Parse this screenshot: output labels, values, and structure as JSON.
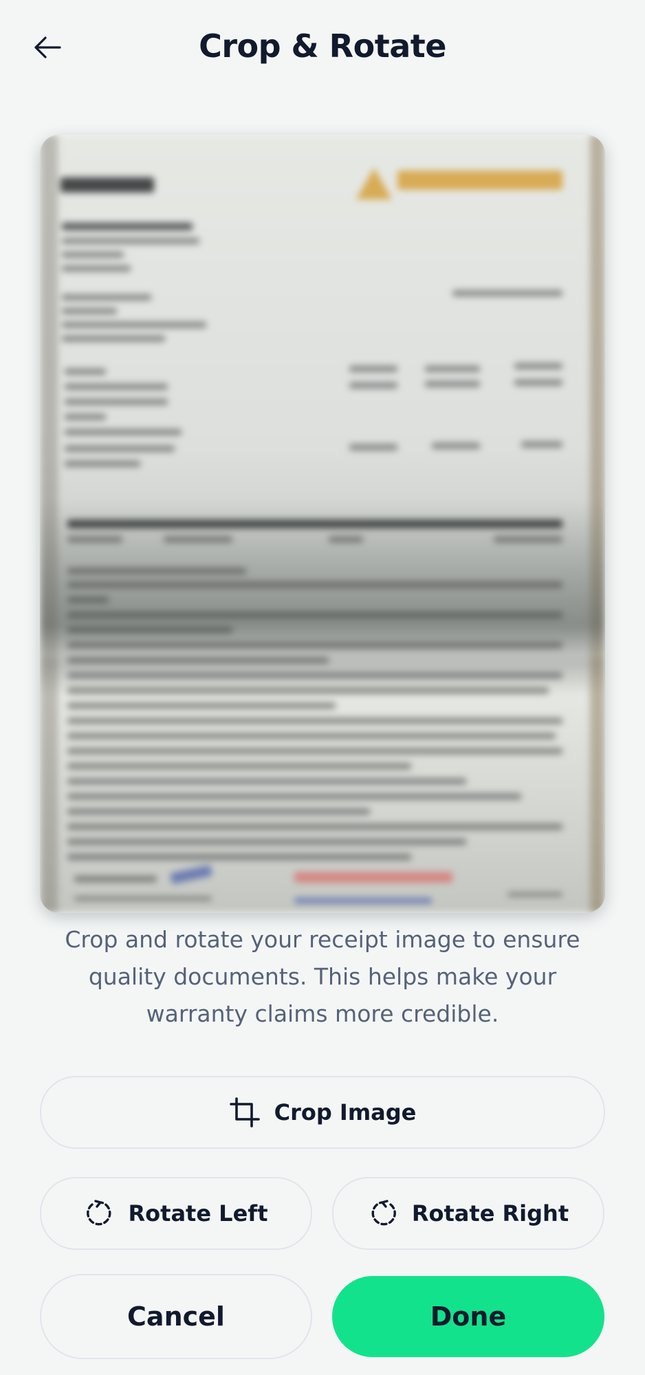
{
  "header": {
    "title": "Crop & Rotate",
    "back_icon": "arrow-left-icon"
  },
  "preview": {
    "image_alt": "Receipt image preview"
  },
  "description": "Crop and rotate your receipt image to ensure quality documents. This helps make your warranty claims more credible.",
  "actions": {
    "crop_label": "Crop Image",
    "crop_icon": "crop-icon",
    "rotate_left_label": "Rotate Left",
    "rotate_left_icon": "rotate-left-icon",
    "rotate_right_label": "Rotate Right",
    "rotate_right_icon": "rotate-right-icon",
    "cancel_label": "Cancel",
    "done_label": "Done"
  },
  "colors": {
    "background": "#f4f6f6",
    "primary": "#13e28c",
    "text": "#121a2d",
    "muted": "#566278"
  }
}
